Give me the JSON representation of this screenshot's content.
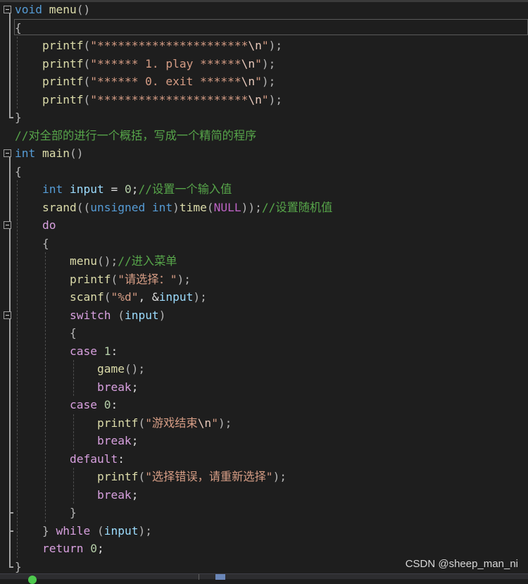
{
  "code_lines": [
    [
      [
        "kw",
        "void"
      ],
      [
        "",
        " "
      ],
      [
        "fn",
        "menu"
      ],
      [
        "pn",
        "()"
      ]
    ],
    [
      [
        "pn",
        "{"
      ]
    ],
    [
      [
        "",
        "    "
      ],
      [
        "fn",
        "printf"
      ],
      [
        "pn",
        "("
      ],
      [
        "str",
        "\"**********************"
      ],
      [
        "esc",
        "\\n"
      ],
      [
        "str",
        "\""
      ],
      [
        "pn",
        ");"
      ]
    ],
    [
      [
        "",
        "    "
      ],
      [
        "fn",
        "printf"
      ],
      [
        "pn",
        "("
      ],
      [
        "str",
        "\"****** 1. play ******"
      ],
      [
        "esc",
        "\\n"
      ],
      [
        "str",
        "\""
      ],
      [
        "pn",
        ");"
      ]
    ],
    [
      [
        "",
        "    "
      ],
      [
        "fn",
        "printf"
      ],
      [
        "pn",
        "("
      ],
      [
        "str",
        "\"****** 0. exit ******"
      ],
      [
        "esc",
        "\\n"
      ],
      [
        "str",
        "\""
      ],
      [
        "pn",
        ");"
      ]
    ],
    [
      [
        "",
        "    "
      ],
      [
        "fn",
        "printf"
      ],
      [
        "pn",
        "("
      ],
      [
        "str",
        "\"**********************"
      ],
      [
        "esc",
        "\\n"
      ],
      [
        "str",
        "\""
      ],
      [
        "pn",
        ");"
      ]
    ],
    [
      [
        "pn",
        "}"
      ]
    ],
    [
      [
        "cmt",
        "//对全部的进行一个概括，写成一个精简的程序"
      ]
    ],
    [
      [
        "kw",
        "int"
      ],
      [
        "",
        " "
      ],
      [
        "fn",
        "main"
      ],
      [
        "pn",
        "()"
      ]
    ],
    [
      [
        "pn",
        "{"
      ]
    ],
    [
      [
        "",
        "    "
      ],
      [
        "kw",
        "int"
      ],
      [
        "",
        " "
      ],
      [
        "var",
        "input"
      ],
      [
        "",
        " = "
      ],
      [
        "num",
        "0"
      ],
      [
        "",
        ";"
      ],
      [
        "cmt",
        "//设置一个输入值"
      ]
    ],
    [
      [
        "",
        "    "
      ],
      [
        "fn",
        "srand"
      ],
      [
        "pn",
        "(("
      ],
      [
        "kw",
        "unsigned int"
      ],
      [
        "pn",
        ")"
      ],
      [
        "fn",
        "time"
      ],
      [
        "pn",
        "("
      ],
      [
        "mac",
        "NULL"
      ],
      [
        "pn",
        "));"
      ],
      [
        "cmt",
        "//设置随机值"
      ]
    ],
    [
      [
        "",
        "    "
      ],
      [
        "ctl",
        "do"
      ]
    ],
    [
      [
        "",
        "    "
      ],
      [
        "pn",
        "{"
      ]
    ],
    [
      [
        "",
        "        "
      ],
      [
        "fn",
        "menu"
      ],
      [
        "pn",
        "();"
      ],
      [
        "cmt",
        "//进入菜单"
      ]
    ],
    [
      [
        "",
        "        "
      ],
      [
        "fn",
        "printf"
      ],
      [
        "pn",
        "("
      ],
      [
        "str",
        "\"请选择：\""
      ],
      [
        "pn",
        ");"
      ]
    ],
    [
      [
        "",
        "        "
      ],
      [
        "fn",
        "scanf"
      ],
      [
        "pn",
        "("
      ],
      [
        "str",
        "\"%d\""
      ],
      [
        "",
        ", &"
      ],
      [
        "var",
        "input"
      ],
      [
        "pn",
        ");"
      ]
    ],
    [
      [
        "",
        "        "
      ],
      [
        "ctl",
        "switch"
      ],
      [
        "",
        " "
      ],
      [
        "pn",
        "("
      ],
      [
        "var",
        "input"
      ],
      [
        "pn",
        ")"
      ]
    ],
    [
      [
        "",
        "        "
      ],
      [
        "pn",
        "{"
      ]
    ],
    [
      [
        "",
        "        "
      ],
      [
        "ctl",
        "case"
      ],
      [
        "",
        " "
      ],
      [
        "num",
        "1"
      ],
      [
        "",
        ":"
      ]
    ],
    [
      [
        "",
        "            "
      ],
      [
        "fn",
        "game"
      ],
      [
        "pn",
        "();"
      ]
    ],
    [
      [
        "",
        "            "
      ],
      [
        "ctl",
        "break"
      ],
      [
        "",
        ";"
      ]
    ],
    [
      [
        "",
        "        "
      ],
      [
        "ctl",
        "case"
      ],
      [
        "",
        " "
      ],
      [
        "num",
        "0"
      ],
      [
        "",
        ":"
      ]
    ],
    [
      [
        "",
        "            "
      ],
      [
        "fn",
        "printf"
      ],
      [
        "pn",
        "("
      ],
      [
        "str",
        "\"游戏结束"
      ],
      [
        "esc",
        "\\n"
      ],
      [
        "str",
        "\""
      ],
      [
        "pn",
        ");"
      ]
    ],
    [
      [
        "",
        "            "
      ],
      [
        "ctl",
        "break"
      ],
      [
        "",
        ";"
      ]
    ],
    [
      [
        "",
        "        "
      ],
      [
        "ctl",
        "default"
      ],
      [
        "",
        ":"
      ]
    ],
    [
      [
        "",
        "            "
      ],
      [
        "fn",
        "printf"
      ],
      [
        "pn",
        "("
      ],
      [
        "str",
        "\"选择错误，请重新选择\""
      ],
      [
        "pn",
        ");"
      ]
    ],
    [
      [
        "",
        "            "
      ],
      [
        "ctl",
        "break"
      ],
      [
        "",
        ";"
      ]
    ],
    [
      [
        "",
        "        "
      ],
      [
        "pn",
        "}"
      ]
    ],
    [
      [
        "",
        "    "
      ],
      [
        "pn",
        "}"
      ],
      [
        "",
        " "
      ],
      [
        "ctl",
        "while"
      ],
      [
        "",
        " "
      ],
      [
        "pn",
        "("
      ],
      [
        "var",
        "input"
      ],
      [
        "pn",
        ");"
      ]
    ],
    [
      [
        "",
        "    "
      ],
      [
        "ctl",
        "return"
      ],
      [
        "",
        " "
      ],
      [
        "num",
        "0"
      ],
      [
        "",
        ";"
      ]
    ],
    [
      [
        "pn",
        "}"
      ]
    ]
  ],
  "watermark": "CSDN @sheep_man_ni"
}
